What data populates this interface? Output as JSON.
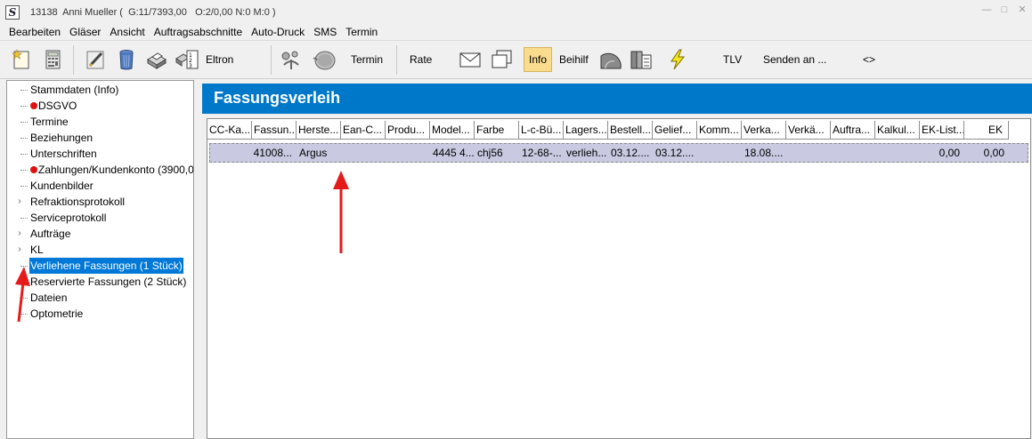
{
  "window": {
    "title": "13138  Anni Mueller (  G:11/7393,00   O:2/0,00 N:0 M:0 )"
  },
  "menu": [
    "Bearbeiten",
    "Gläser",
    "Ansicht",
    "Auftragsabschnitte",
    "Auto-Druck",
    "SMS",
    "Termin"
  ],
  "toolbar": {
    "eltron": "Eltron",
    "termin": "Termin",
    "rate": "Rate",
    "info": "Info",
    "beihilf": "Beihilf",
    "tlv": "TLV",
    "senden": "Senden an ...",
    "arrows": "<>"
  },
  "tree": [
    {
      "label": "Stammdaten (Info)"
    },
    {
      "label": "DSGVO",
      "dot": true
    },
    {
      "label": "Termine"
    },
    {
      "label": "Beziehungen"
    },
    {
      "label": "Unterschriften"
    },
    {
      "label": "Zahlungen/Kundenkonto (3900,0",
      "dot": true
    },
    {
      "label": "Kundenbilder"
    },
    {
      "label": "Refraktionsprotokoll",
      "expand": true
    },
    {
      "label": "Serviceprotokoll"
    },
    {
      "label": "Aufträge",
      "expand": true
    },
    {
      "label": "KL",
      "expand": true
    },
    {
      "label": "Verliehene Fassungen (1 Stück)",
      "selected": true
    },
    {
      "label": "Reservierte Fassungen (2 Stück)"
    },
    {
      "label": "Dateien"
    },
    {
      "label": "Optometrie"
    }
  ],
  "main": {
    "title": "Fassungsverleih",
    "columns": [
      "CC-Ka...",
      "Fassun...",
      "Herste...",
      "Ean-C...",
      "Produ...",
      "Model...",
      "Farbe",
      "L-c-Bü...",
      "Lagers...",
      "Bestell...",
      "Gelief...",
      "Komm...",
      "Verka...",
      "Verkä...",
      "Auftra...",
      "Kalkul...",
      "EK-List...",
      "EK"
    ],
    "rows": [
      [
        "",
        "41008...",
        "Argus",
        "",
        "",
        "4445 4...",
        "chj56",
        "12-68-...",
        "verlieh...",
        "03.12....",
        "03.12....",
        "",
        "18.08....",
        "",
        "",
        "",
        "0,00",
        "0,00"
      ]
    ]
  }
}
